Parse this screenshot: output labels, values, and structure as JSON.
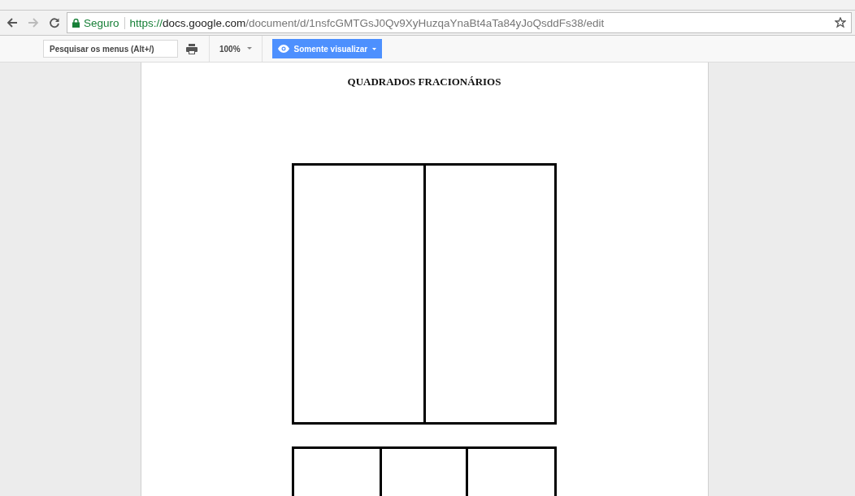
{
  "browser": {
    "security_label": "Seguro",
    "url_scheme": "https://",
    "url_host": "docs.google.com",
    "url_path": "/document/d/1nsfcGMTGsJ0Qv9XyHuzqaYnaBt4aTa84yJoQsddFs38/edit"
  },
  "toolbar": {
    "search": {
      "placeholder": "Pesquisar os menus (Alt+/)"
    },
    "zoom": "100%",
    "mode_button": "Somente visualizar"
  },
  "document": {
    "title": "QUADRADOS FRACIONÁRIOS",
    "shapes": [
      {
        "kind": "halves"
      },
      {
        "kind": "thirds"
      }
    ]
  }
}
